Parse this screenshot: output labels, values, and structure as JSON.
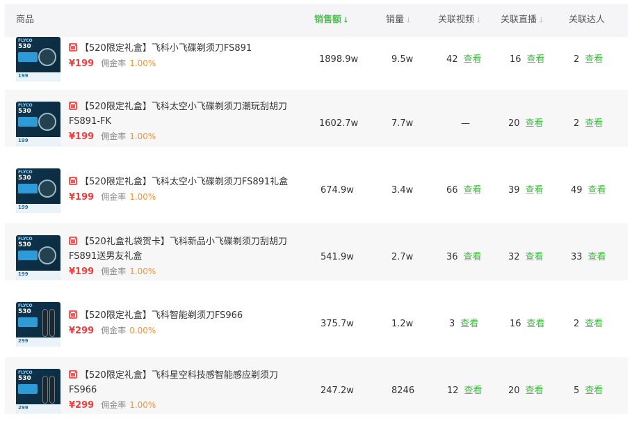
{
  "header": {
    "product": "商品",
    "sales_amount": "销售额",
    "sales_volume": "销量",
    "videos": "关联视频",
    "lives": "关联直播",
    "influencers": "关联达人",
    "sort_icon_active": "arrow-down-icon",
    "sort_icon_inactive": "arrow-down-icon"
  },
  "view_label": "查看",
  "commission_label": "佣金率",
  "rows": [
    {
      "tag": "【520限定礼盒】",
      "title": "飞科小飞碟剃须刀FS891",
      "price": "¥199",
      "commission": "1.00%",
      "sales_amount": "1898.9w",
      "sales_volume": "9.5w",
      "videos": "42",
      "lives": "16",
      "influencers": "2",
      "thumb_brand": "FLYCO",
      "thumb_big": "530",
      "thumb_price": "199"
    },
    {
      "tag": "【520限定礼盒】",
      "title": "飞科太空小飞碟剃须刀潮玩刮胡刀FS891-FK",
      "price": "¥199",
      "commission": "1.00%",
      "sales_amount": "1602.7w",
      "sales_volume": "7.7w",
      "videos": "—",
      "lives": "20",
      "influencers": "2",
      "thumb_brand": "FLYCO",
      "thumb_big": "530",
      "thumb_price": "199"
    },
    {
      "tag": "【520限定礼盒】",
      "title": "飞科太空小飞碟剃须刀FS891礼盒",
      "price": "¥199",
      "commission": "1.00%",
      "sales_amount": "674.9w",
      "sales_volume": "3.4w",
      "videos": "66",
      "lives": "39",
      "influencers": "49",
      "thumb_brand": "FLYCO",
      "thumb_big": "530",
      "thumb_price": "199"
    },
    {
      "tag": "【520礼盒礼袋贺卡】",
      "title": "飞科新品小飞碟剃须刀刮胡刀FS891送男友礼盒",
      "price": "¥199",
      "commission": "1.00%",
      "sales_amount": "541.9w",
      "sales_volume": "2.7w",
      "videos": "36",
      "lives": "32",
      "influencers": "33",
      "thumb_brand": "FLYCO",
      "thumb_big": "530",
      "thumb_price": "199"
    },
    {
      "tag": "【520限定礼盒】",
      "title": "飞科智能剃须刀FS966",
      "price": "¥299",
      "commission": "0.00%",
      "sales_amount": "375.7w",
      "sales_volume": "1.2w",
      "videos": "3",
      "lives": "16",
      "influencers": "2",
      "thumb_brand": "FLYCO",
      "thumb_big": "530",
      "thumb_price": "299"
    },
    {
      "tag": "【520限定礼盒】",
      "title": "飞科星空科技感智能感应剃须刀FS966",
      "price": "¥299",
      "commission": "1.00%",
      "sales_amount": "247.2w",
      "sales_volume": "8246",
      "videos": "12",
      "lives": "20",
      "influencers": "5",
      "thumb_brand": "FLYCO",
      "thumb_big": "530",
      "thumb_price": "299"
    }
  ],
  "colors": {
    "accent_green": "#4fbf4f",
    "price_red": "#f03e3e",
    "commission_orange": "#f0943d"
  }
}
